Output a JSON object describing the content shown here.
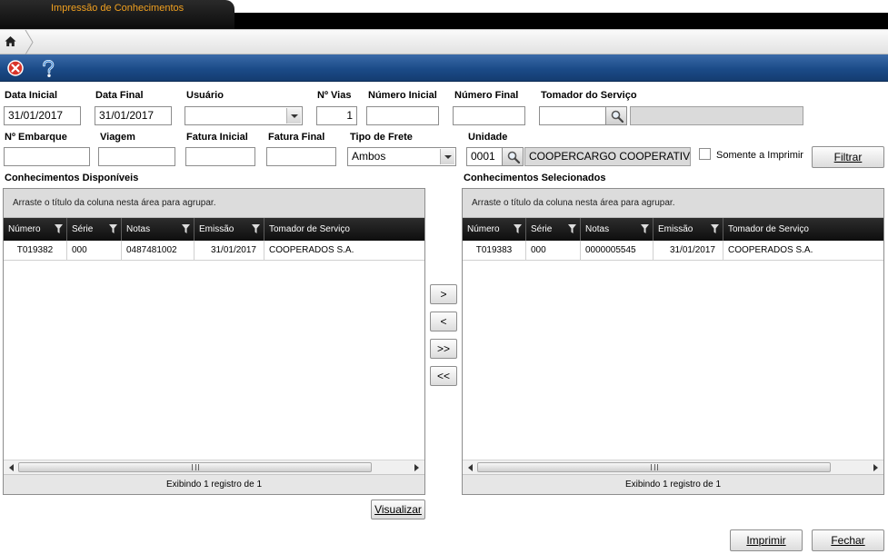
{
  "window": {
    "title": "Impressão de Conhecimentos"
  },
  "icons": {
    "home": "home-icon",
    "close": "close-circle-icon",
    "help": "help-question-icon",
    "search": "magnifier-icon",
    "filter": "filter-funnel-icon"
  },
  "colors": {
    "toolbar_blue": "#1b4b88",
    "tab_title": "#f0a020",
    "grid_header": "#1a1a1a"
  },
  "form": {
    "data_inicial": {
      "label": "Data Inicial",
      "value": "31/01/2017"
    },
    "data_final": {
      "label": "Data Final",
      "value": "31/01/2017"
    },
    "usuario": {
      "label": "Usuário",
      "value": ""
    },
    "n_vias": {
      "label": "Nº Vias",
      "value": "1"
    },
    "numero_inicial": {
      "label": "Número Inicial",
      "value": ""
    },
    "numero_final": {
      "label": "Número Final",
      "value": ""
    },
    "tomador": {
      "label": "Tomador do Serviço",
      "code": "",
      "name": ""
    },
    "n_embarque": {
      "label": "Nº Embarque",
      "value": ""
    },
    "viagem": {
      "label": "Viagem",
      "value": ""
    },
    "fatura_inicial": {
      "label": "Fatura Inicial",
      "value": ""
    },
    "fatura_final": {
      "label": "Fatura Final",
      "value": ""
    },
    "tipo_frete": {
      "label": "Tipo de Frete",
      "value": "Ambos"
    },
    "unidade": {
      "label": "Unidade",
      "code": "0001",
      "name": "COOPERCARGO COOPERATIV..."
    },
    "somente_imprimir": {
      "label": "Somente a Imprimir",
      "checked": false
    },
    "filtrar_label": "Filtrar"
  },
  "grids": {
    "disponiveis": {
      "title": "Conhecimentos Disponíveis",
      "group_hint": "Arraste o título da coluna nesta área para agrupar.",
      "columns": [
        "Número",
        "Série",
        "Notas",
        "Emissão",
        "Tomador de Serviço"
      ],
      "rows": [
        {
          "numero": "T019382",
          "serie": "000",
          "notas": "0487481002",
          "emissao": "31/01/2017",
          "tomador": "COOPERADOS S.A."
        }
      ],
      "footer": "Exibindo 1 registro de 1"
    },
    "selecionados": {
      "title": "Conhecimentos Selecionados",
      "group_hint": "Arraste o título da coluna nesta área para agrupar.",
      "columns": [
        "Número",
        "Série",
        "Notas",
        "Emissão",
        "Tomador de Serviço"
      ],
      "rows": [
        {
          "numero": "T019383",
          "serie": "000",
          "notas": "0000005545",
          "emissao": "31/01/2017",
          "tomador": "COOPERADOS S.A."
        }
      ],
      "footer": "Exibindo 1 registro de 1"
    }
  },
  "move_buttons": {
    "add": ">",
    "remove": "<",
    "add_all": ">>",
    "remove_all": "<<"
  },
  "actions": {
    "visualizar": "Visualizar",
    "imprimir": "Imprimir",
    "fechar": "Fechar"
  }
}
